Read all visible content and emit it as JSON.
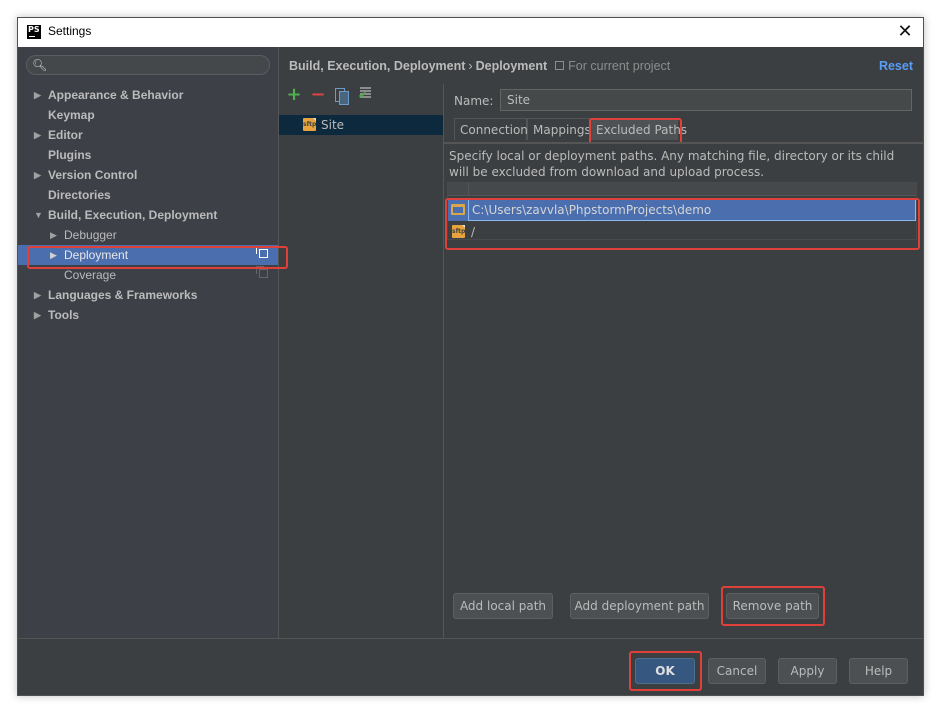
{
  "window": {
    "title": "Settings",
    "logo_text": "PS",
    "close_glyph": "✕"
  },
  "sidebar": {
    "search_placeholder": "",
    "search_icon": "search-icon",
    "items": [
      {
        "label": "Appearance & Behavior",
        "arrow": "▶",
        "level": 0
      },
      {
        "label": "Keymap",
        "arrow": "",
        "level": 0
      },
      {
        "label": "Editor",
        "arrow": "▶",
        "level": 0
      },
      {
        "label": "Plugins",
        "arrow": "",
        "level": 0
      },
      {
        "label": "Version Control",
        "arrow": "▶",
        "level": 0
      },
      {
        "label": "Directories",
        "arrow": "",
        "level": 0
      },
      {
        "label": "Build, Execution, Deployment",
        "arrow": "▼",
        "level": 0
      },
      {
        "label": "Debugger",
        "arrow": "▶",
        "level": 1
      },
      {
        "label": "Deployment",
        "arrow": "▶",
        "level": 1,
        "selected": true
      },
      {
        "label": "Coverage",
        "arrow": "",
        "level": 1
      },
      {
        "label": "Languages & Frameworks",
        "arrow": "▶",
        "level": 0
      },
      {
        "label": "Tools",
        "arrow": "▶",
        "level": 0
      }
    ]
  },
  "header": {
    "breadcrumb_parent": "Build, Execution, Deployment",
    "breadcrumb_sep": "›",
    "breadcrumb_current": "Deployment",
    "scope": "For current project",
    "reset_label": "Reset"
  },
  "servers": {
    "toolbar": {
      "add": "+",
      "remove": "−"
    },
    "items": [
      {
        "name": "Site",
        "type": "sftp"
      }
    ],
    "sftp_badge": "sftp"
  },
  "config": {
    "name_label": "Name:",
    "name_value": "Site",
    "tabs": [
      "Connection",
      "Mappings",
      "Excluded Paths"
    ],
    "active_tab": "Excluded Paths",
    "description": "Specify local or deployment paths. Any matching file, directory or its child will be excluded from download and upload process.",
    "paths": [
      {
        "type": "local",
        "path": "C:\\Users\\zavvla\\PhpstormProjects\\demo",
        "selected": true
      },
      {
        "type": "deployment",
        "path": "/",
        "selected": false
      }
    ],
    "buttons": {
      "add_local": "Add local path",
      "add_deployment": "Add deployment path",
      "remove": "Remove path"
    }
  },
  "footer": {
    "ok": "OK",
    "cancel": "Cancel",
    "apply": "Apply",
    "help": "Help"
  },
  "colors": {
    "highlight": "#e0403a",
    "selection": "#4b6eaf",
    "link": "#589df6"
  }
}
